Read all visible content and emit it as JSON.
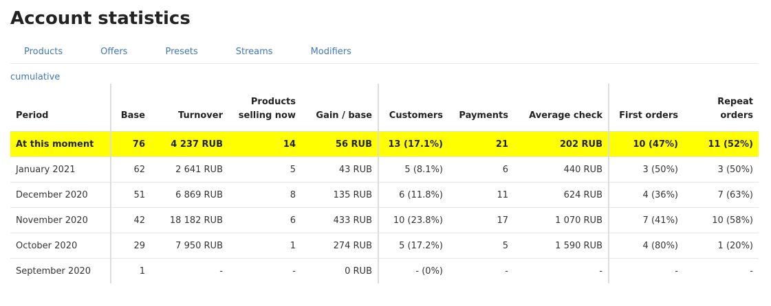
{
  "page": {
    "title": "Account statistics"
  },
  "tabs": [
    "Products",
    "Offers",
    "Presets",
    "Streams",
    "Modifiers"
  ],
  "mode_link": "cumulative",
  "table": {
    "headers": {
      "period": "Period",
      "base": "Base",
      "turnover": "Turnover",
      "products_line1": "Products",
      "products_line2": "selling now",
      "gain": "Gain / base",
      "customers": "Customers",
      "payments": "Payments",
      "average_check": "Average check",
      "first_orders": "First orders",
      "repeat_orders": "Repeat orders"
    },
    "rows": [
      {
        "period": "At this moment",
        "base": "76",
        "turnover": "4 237 RUB",
        "products": "14",
        "gain": "56 RUB",
        "customers": "13 (17.1%)",
        "payments": "21",
        "average_check": "202 RUB",
        "first_orders": "10 (47%)",
        "repeat_orders": "11 (52%)"
      },
      {
        "period": "January 2021",
        "base": "62",
        "turnover": "2 641 RUB",
        "products": "5",
        "gain": "43 RUB",
        "customers": "5 (8.1%)",
        "payments": "6",
        "average_check": "440 RUB",
        "first_orders": "3 (50%)",
        "repeat_orders": "3 (50%)"
      },
      {
        "period": "December 2020",
        "base": "51",
        "turnover": "6 869 RUB",
        "products": "8",
        "gain": "135 RUB",
        "customers": "6 (11.8%)",
        "payments": "11",
        "average_check": "624 RUB",
        "first_orders": "4 (36%)",
        "repeat_orders": "7 (63%)"
      },
      {
        "period": "November 2020",
        "base": "42",
        "turnover": "18 182 RUB",
        "products": "6",
        "gain": "433 RUB",
        "customers": "10 (23.8%)",
        "payments": "17",
        "average_check": "1 070 RUB",
        "first_orders": "7 (41%)",
        "repeat_orders": "10 (58%)"
      },
      {
        "period": "October 2020",
        "base": "29",
        "turnover": "7 950 RUB",
        "products": "1",
        "gain": "274 RUB",
        "customers": "5 (17.2%)",
        "payments": "5",
        "average_check": "1 590 RUB",
        "first_orders": "4 (80%)",
        "repeat_orders": "1 (20%)"
      },
      {
        "period": "September 2020",
        "base": "1",
        "turnover": "-",
        "products": "-",
        "gain": "0 RUB",
        "customers": "- (0%)",
        "payments": "-",
        "average_check": "-",
        "first_orders": "-",
        "repeat_orders": "-"
      }
    ]
  },
  "colors": {
    "highlight": "#ffff00",
    "link": "#3f78b5"
  }
}
